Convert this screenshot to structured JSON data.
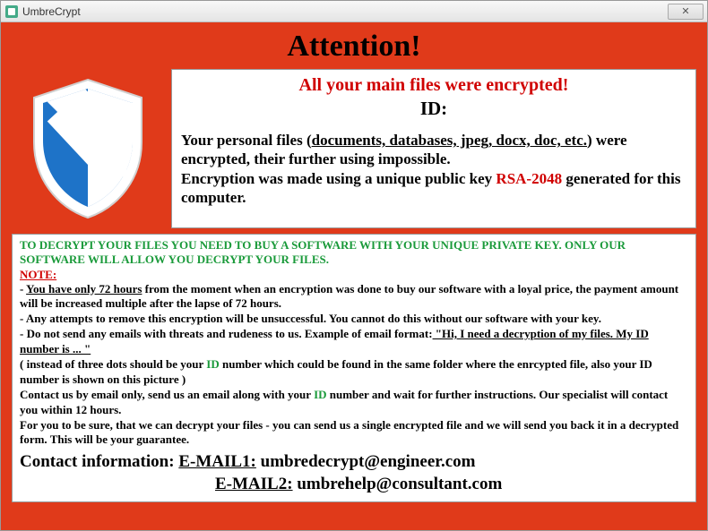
{
  "window": {
    "title": "UmbreCrypt",
    "close_glyph": "✕"
  },
  "headline": "Attention!",
  "panel": {
    "heading": "All your main files were encrypted!",
    "id_label": "ID:",
    "line1_a": "Your personal files (",
    "line1_b": "documents, databases, jpeg, docx, doc, etc.",
    "line1_c": ") were encrypted, their further using impossible.",
    "line2_a": "Encryption was made using a unique public key ",
    "line2_rsa": "RSA-2048",
    "line2_b": " generated for this computer."
  },
  "bottom": {
    "green": "TO DECRYPT YOUR FILES YOU NEED TO BUY A SOFTWARE WITH YOUR UNIQUE PRIVATE KEY. ONLY OUR SOFTWARE WILL ALLOW YOU DECRYPT YOUR FILES.",
    "note": "NOTE:",
    "l1_a": "- ",
    "l1_u": "You have only 72 hours",
    "l1_b": " from the moment when an encryption was done to buy our software with a loyal price, the payment amount will be increased multiple after the lapse of 72 hours.",
    "l2": "- Any attempts to remove this encryption will be unsuccessful. You cannot do this without our software with your key.",
    "l3_a": "- Do not send any emails with threats and rudeness to us. Example of email format:",
    "l3_u": " \"Hi, I need a decryption of my files. My ID number is ... \"",
    "l4_a": "( instead of three dots should be your ",
    "l4_id": "ID",
    "l4_b": " number which could be found in the same folder where the enrcypted file, also your ID number is shown on this picture )",
    "l5_a": "Contact us by email only, send us an email along with your ",
    "l5_id": "ID",
    "l5_b": " number and wait for further instructions. Our specialist will contact you within 12 hours.",
    "l6": "For you to be sure, that we can decrypt your files - you can send us a single encrypted file and we will send you back it in a decrypted form. This will be your guarantee."
  },
  "contact": {
    "label": "Contact information: ",
    "e1_label": "E-MAIL1:",
    "e1_value": " umbredecrypt@engineer.com",
    "e2_label": "E-MAIL2:",
    "e2_value": " umbrehelp@consultant.com"
  }
}
